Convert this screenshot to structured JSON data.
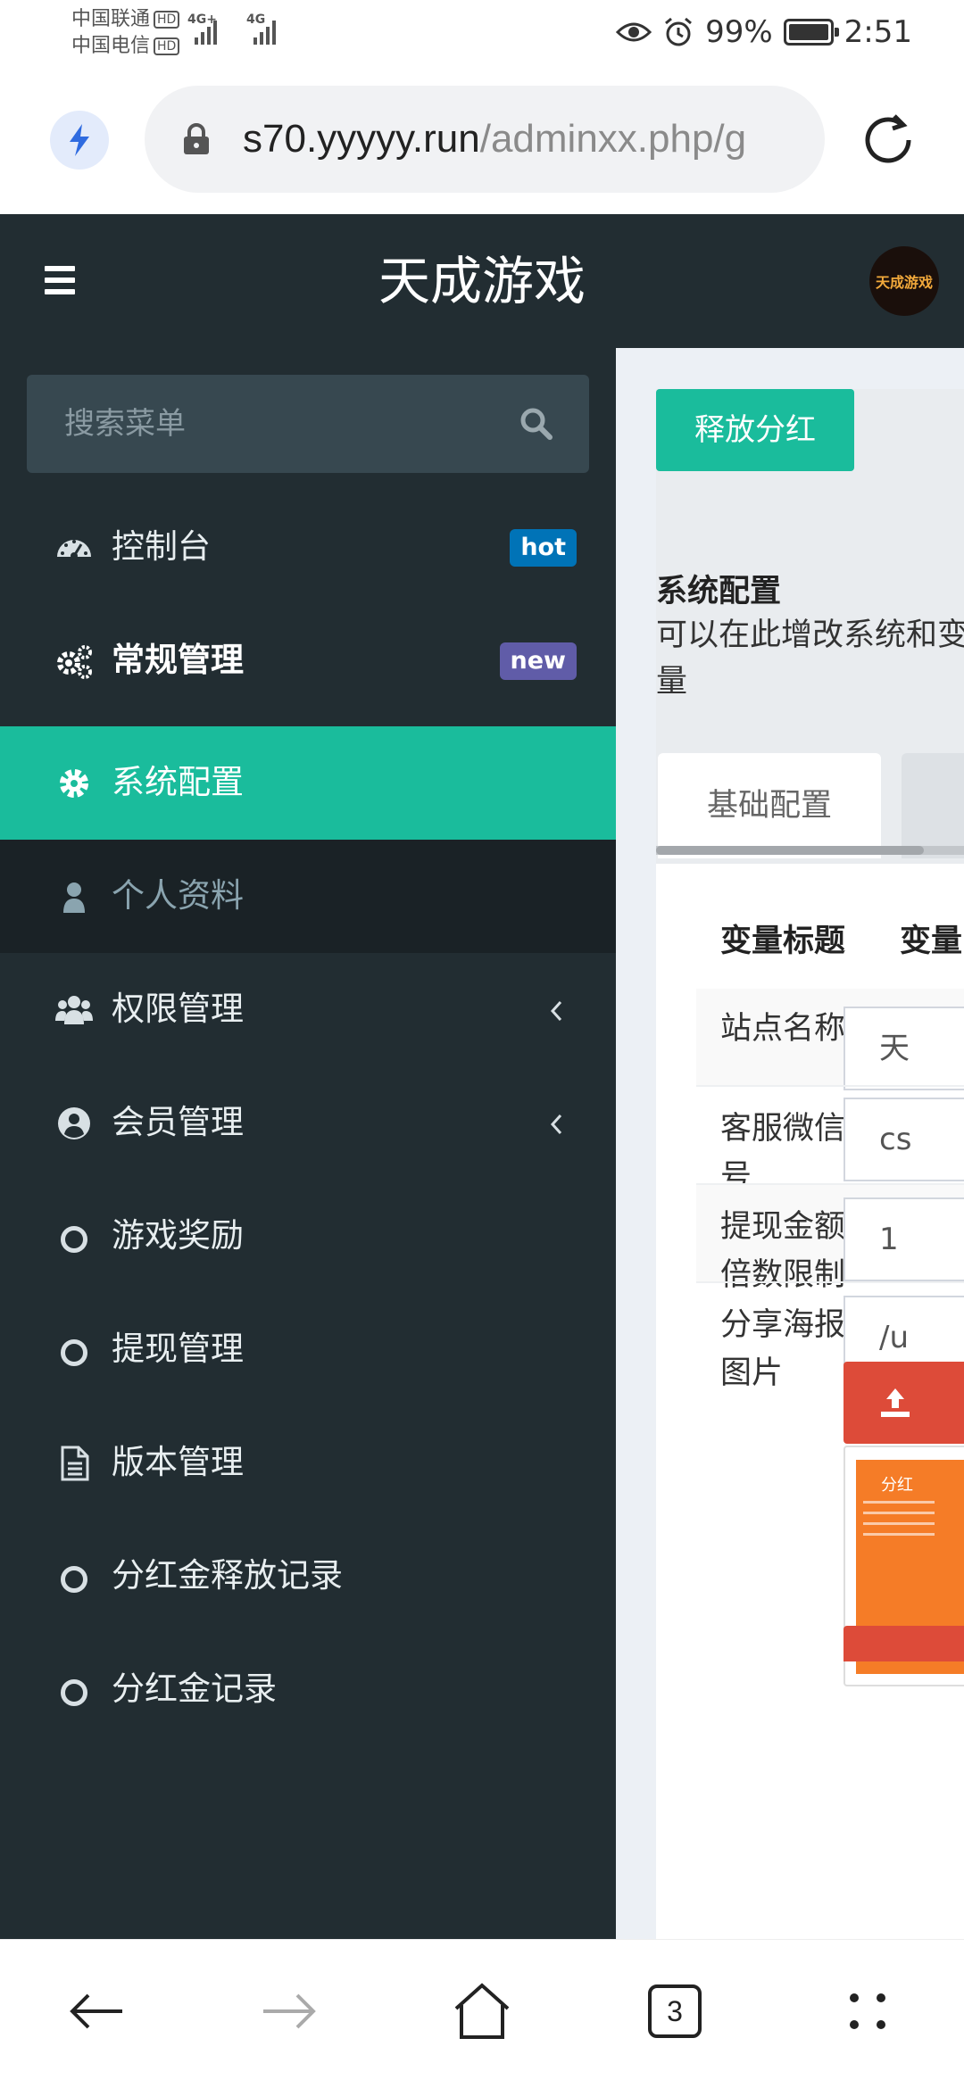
{
  "status_bar": {
    "carrier1": "中国联通",
    "carrier2": "中国电信",
    "hd_label": "HD",
    "network1": "4G+",
    "network2": "4G",
    "battery_percent_text": "99%",
    "battery_level": 0.99,
    "time": "2:51",
    "icons": [
      "eye-icon",
      "alarm-icon",
      "battery-icon"
    ]
  },
  "browser": {
    "url_host": "s70.yyyyy.run",
    "url_path": "/adminxx.php/g",
    "icons": [
      "bolt-icon",
      "lock-icon",
      "reload-icon"
    ]
  },
  "header": {
    "title": "天成游戏",
    "avatar_text": "天成游戏"
  },
  "sidebar": {
    "search_placeholder": "搜索菜单",
    "items": [
      {
        "label": "控制台",
        "icon": "dashboard-icon",
        "badge": "hot",
        "badge_color": "#0073b7"
      },
      {
        "label": "常规管理",
        "icon": "cogs-icon",
        "badge": "new",
        "badge_color": "#605ca8"
      },
      {
        "label": "系统配置",
        "icon": "gear-icon",
        "active": true
      },
      {
        "label": "个人资料",
        "icon": "user-icon",
        "submenu": true
      },
      {
        "label": "权限管理",
        "icon": "users-icon",
        "has_children": true
      },
      {
        "label": "会员管理",
        "icon": "user-circle-icon",
        "has_children": true
      },
      {
        "label": "游戏奖励",
        "icon": "circle-icon"
      },
      {
        "label": "提现管理",
        "icon": "circle-icon"
      },
      {
        "label": "版本管理",
        "icon": "file-icon"
      },
      {
        "label": "分红金释放记录",
        "icon": "circle-icon"
      },
      {
        "label": "分红金记录",
        "icon": "circle-icon"
      }
    ]
  },
  "content": {
    "release_button": "释放分红",
    "config_title": "系统配置",
    "config_desc": "可以在此增改系统和变量",
    "tabs": [
      "基础配置"
    ],
    "table_headers": [
      "变量标题",
      "变量"
    ],
    "rows": [
      {
        "label": "站点名称",
        "value": "天"
      },
      {
        "label": "客服微信号",
        "value": "cs"
      },
      {
        "label": "提现金额倍数限制",
        "value": "1"
      },
      {
        "label": "分享海报图片",
        "value": "/u"
      }
    ],
    "poster_caption": "分红"
  },
  "bottom_nav": {
    "tab_count": "3",
    "icons": [
      "back-icon",
      "forward-icon",
      "home-icon",
      "tabs-icon",
      "menu-icon"
    ]
  },
  "colors": {
    "sidebar_bg": "#222d32",
    "accent": "#1abc9c",
    "danger": "#dd4b39"
  }
}
